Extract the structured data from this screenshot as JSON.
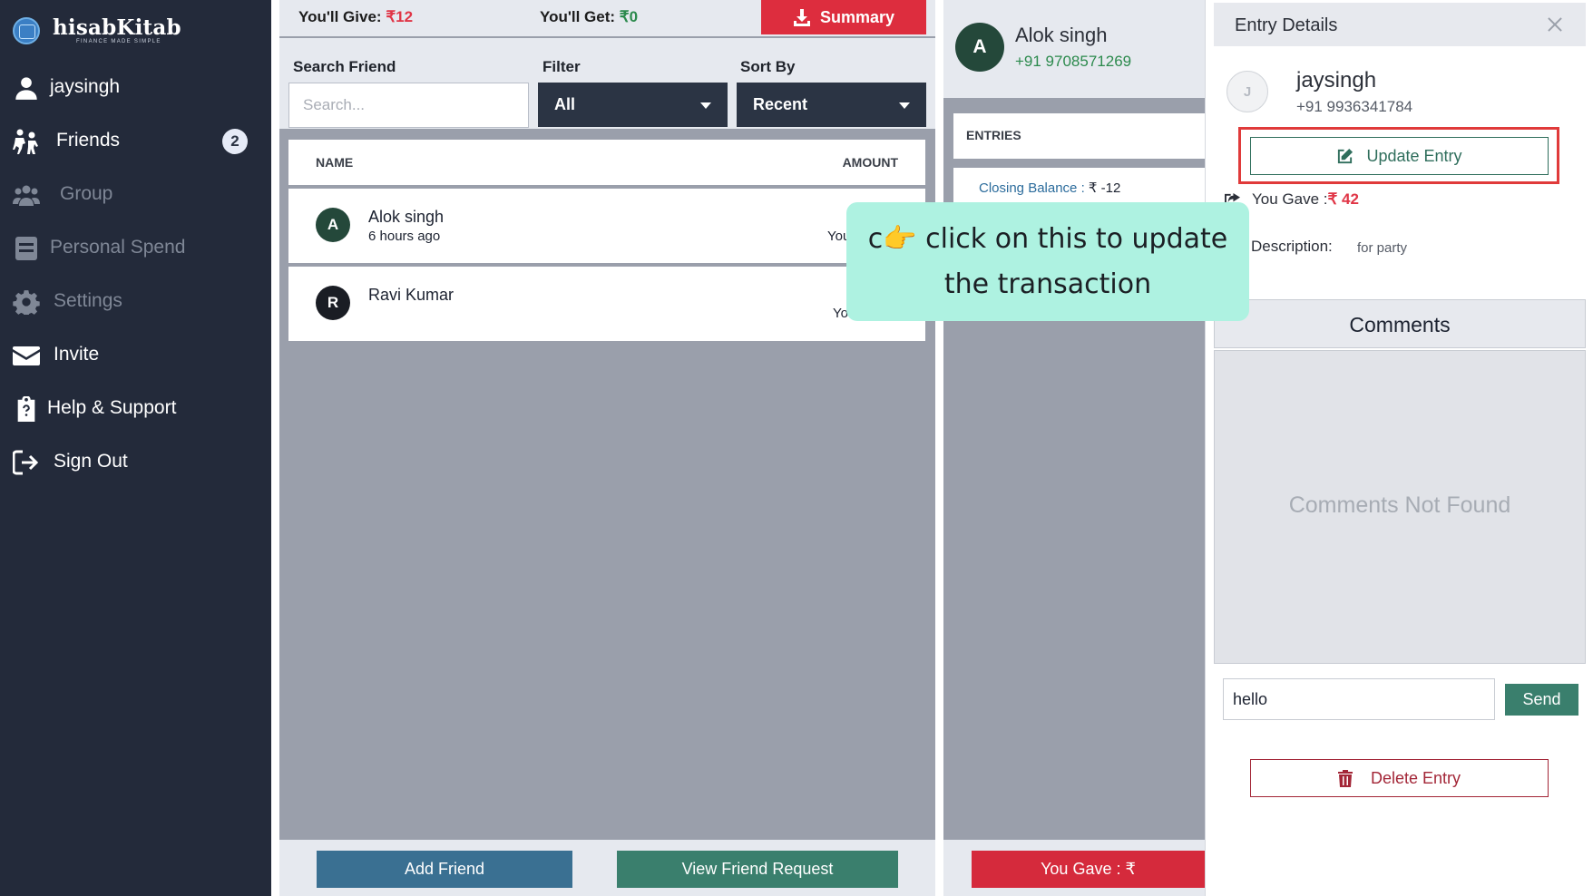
{
  "app": {
    "name": "hisabKitab",
    "tagline": "FINANCE MADE SIMPLE"
  },
  "sidebar": {
    "items": [
      {
        "label": "jaysingh",
        "icon": "user-icon"
      },
      {
        "label": "Friends",
        "icon": "friends-icon",
        "badge": "2"
      },
      {
        "label": "Group",
        "icon": "group-icon"
      },
      {
        "label": "Personal Spend",
        "icon": "wallet-icon"
      },
      {
        "label": "Settings",
        "icon": "gear-icon"
      },
      {
        "label": "Invite",
        "icon": "envelope-icon"
      },
      {
        "label": "Help & Support",
        "icon": "clipboard-question-icon"
      },
      {
        "label": "Sign Out",
        "icon": "sign-out-icon"
      }
    ]
  },
  "friends_panel": {
    "give_label": "You'll Give:",
    "give_value": "₹12",
    "get_label": "You'll Get:",
    "get_value": "₹0",
    "summary_label": "Summary",
    "search_label": "Search Friend",
    "search_placeholder": "Search...",
    "filter_label": "Filter",
    "filter_value": "All",
    "sort_label": "Sort By",
    "sort_value": "Recent",
    "columns": {
      "name": "NAME",
      "amount": "AMOUNT"
    },
    "rows": [
      {
        "initial": "A",
        "name": "Alok singh",
        "time": "6 hours ago",
        "amount_text": "You",
        "avatar_color": "#24483a"
      },
      {
        "initial": "R",
        "name": "Ravi Kumar",
        "time": "",
        "amount_text": "You",
        "avatar_color": "#1a1d24"
      }
    ],
    "add_friend_label": "Add Friend",
    "view_requests_label": "View Friend Request"
  },
  "friend_detail": {
    "initial": "A",
    "name": "Alok singh",
    "phone": "+91 9708571269",
    "entries_label": "ENTRIES",
    "closing_label": "Closing Balance : ",
    "closing_value": "₹ -12",
    "you_gave_button": "You Gave : ₹"
  },
  "entry_details": {
    "title": "Entry Details",
    "initial": "J",
    "name": "jaysingh",
    "phone": "+91 9936341784",
    "update_label": "Update Entry",
    "gave_label": "You Gave :",
    "gave_value": "₹ 42",
    "description_label": "Description:",
    "description_value": "for party",
    "comments_title": "Comments",
    "no_comments": "Comments Not Found",
    "comment_input_value": "hello",
    "send_label": "Send",
    "delete_label": "Delete Entry"
  },
  "callout": {
    "line1_prefix": "c",
    "line1": "click on this to update",
    "line2": "the transaction"
  },
  "colors": {
    "sidebar_bg": "#232a3a",
    "accent_red": "#dd2d3e",
    "accent_green": "#3a7f6d",
    "accent_blue": "#3a7092",
    "callout_bg": "#aef2e1"
  }
}
